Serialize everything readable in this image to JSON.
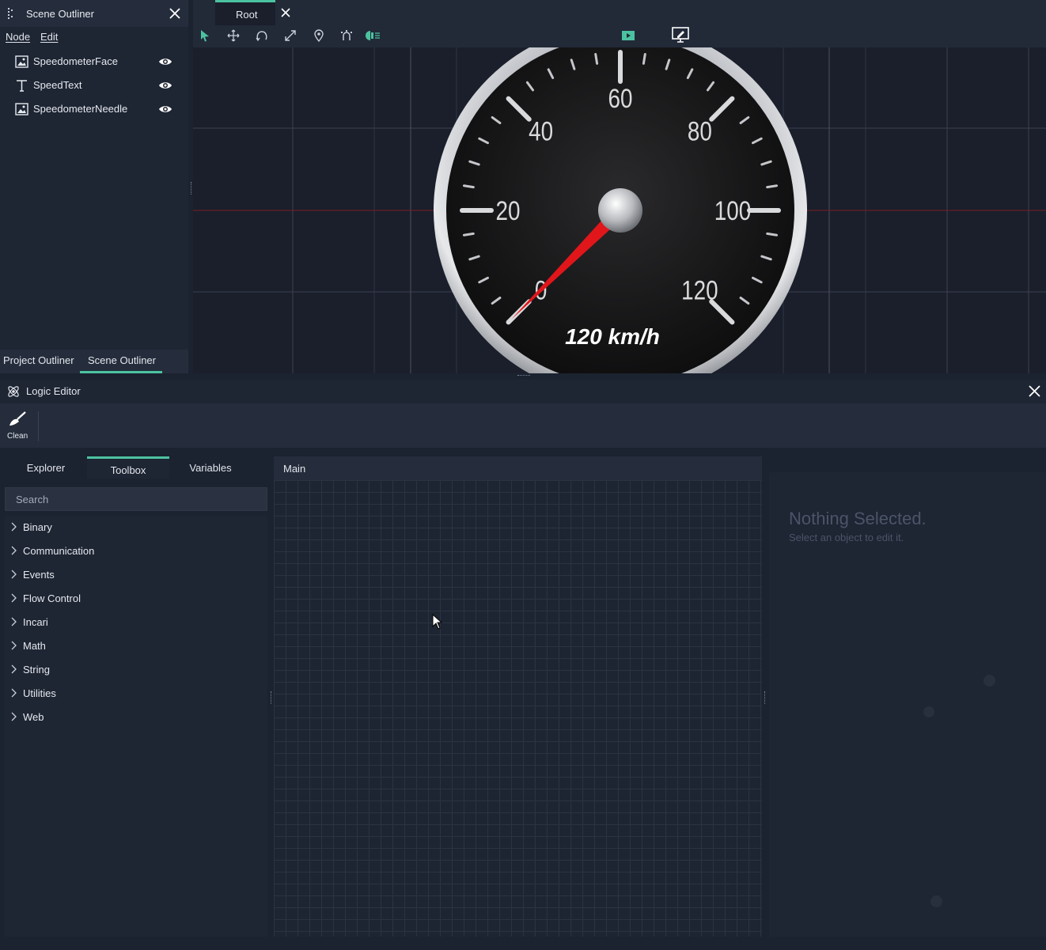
{
  "scene_outliner": {
    "title": "Scene Outliner",
    "menu": [
      "Node",
      "Edit"
    ],
    "nodes": [
      {
        "label": "SpeedometerFace",
        "icon": "image-icon"
      },
      {
        "label": "SpeedText",
        "icon": "text-icon"
      },
      {
        "label": "SpeedometerNeedle",
        "icon": "image-icon"
      }
    ],
    "bottom_tabs": [
      "Project Outliner",
      "Scene Outliner"
    ],
    "active_bottom_tab": "Scene Outliner"
  },
  "viewport": {
    "tab": "Root",
    "gauge": {
      "tick_labels": [
        "0",
        "20",
        "40",
        "60",
        "80",
        "100",
        "120"
      ],
      "speed_text": "120 km/h",
      "needle_value": 0
    }
  },
  "logic_editor": {
    "title": "Logic Editor",
    "toolbar": {
      "clean_label": "Clean"
    },
    "left_tabs": [
      "Explorer",
      "Toolbox",
      "Variables"
    ],
    "active_left_tab": "Toolbox",
    "search_placeholder": "Search",
    "toolbox_categories": [
      "Binary",
      "Communication",
      "Events",
      "Flow Control",
      "Incari",
      "Math",
      "String",
      "Utilities",
      "Web"
    ],
    "graph_tab": "Main",
    "properties": {
      "title": "Nothing Selected.",
      "subtitle": "Select an object to edit it."
    }
  },
  "colors": {
    "accent": "#4cc3a0",
    "needle": "#e0161b"
  }
}
